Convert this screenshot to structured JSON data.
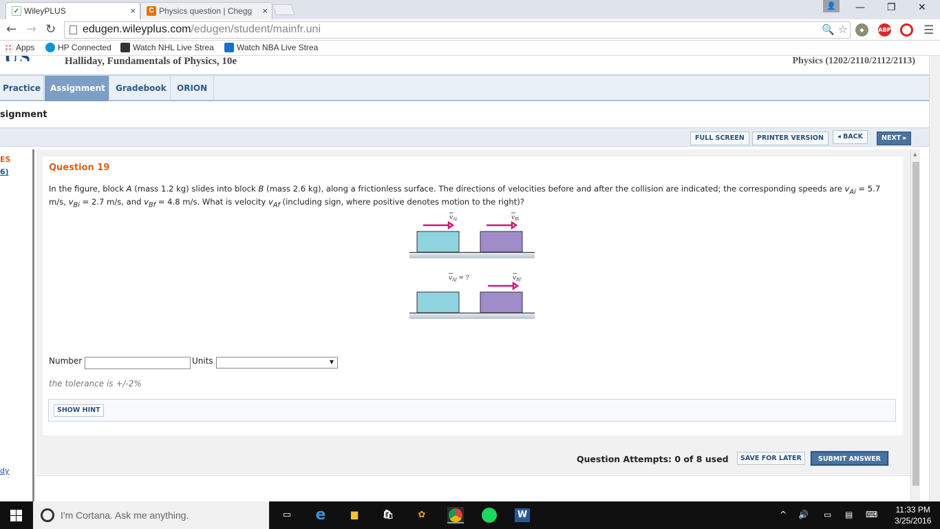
{
  "browser": {
    "tabs": [
      {
        "title": "WileyPLUS",
        "active": true
      },
      {
        "title": "Physics question | Chegg",
        "active": false
      }
    ],
    "tab_close": "×",
    "window_controls": {
      "minimize": "—",
      "restore": "❐",
      "close": "✕"
    },
    "url_host": "edugen.wileyplus.com",
    "url_path": "/edugen/student/mainfr.uni",
    "extension_abp": "ABP",
    "bookmarks": [
      {
        "label": "Apps",
        "icon": "apps-grid-icon"
      },
      {
        "label": "HP Connected",
        "icon": "hp-icon"
      },
      {
        "label": "Watch NHL Live Strea",
        "icon": "nhl-icon"
      },
      {
        "label": "Watch NBA Live Strea",
        "icon": "nba-icon"
      }
    ]
  },
  "wiley": {
    "book_title": "Halliday, Fundamentals of Physics, 10e",
    "course_title": "Physics (1202/2110/2112/2113)",
    "main_tabs": [
      "Practice",
      "Assignment",
      "Gradebook",
      "ORION"
    ],
    "active_tab": "Assignment",
    "breadcrumb": "signment",
    "toolbar": {
      "full_screen": "FULL SCREEN",
      "printer_version": "PRINTER VERSION",
      "back": "◂ BACK",
      "next": "NEXT ▸"
    },
    "left_strip": {
      "line1": "ES",
      "line2": "6)",
      "bottom_link": "dy"
    },
    "question": {
      "title": "Question 19",
      "text_parts": {
        "p1": "In the figure, block ",
        "A": "A",
        "p2": " (mass 1.2 kg) slides into block ",
        "B": "B",
        "p3": " (mass 2.6 kg), along a frictionless surface. The directions of velocities before and after the collision are indicated; the corresponding speeds are ",
        "vAi": "v",
        "vAi_sub": "Ai",
        "p4": " = 5.7 m/s, ",
        "vBi": "v",
        "vBi_sub": "Bi",
        "p5": " = 2.7 m/s, and ",
        "vBf": "v",
        "vBf_sub": "Bf",
        "p6": " = 4.8 m/s. What is velocity ",
        "vAf": "v",
        "vAf_sub": "Af",
        "p7": " (including sign, where positive denotes motion to the right)?"
      },
      "figure": {
        "label_vAi": "v",
        "label_vAi_sub": "Ai",
        "label_vBi": "v",
        "label_vBi_sub": "Bi",
        "label_vAf": "v",
        "label_vAf_sub": "Af",
        "label_vAf_suffix": " = ?",
        "label_vBf": "v",
        "label_vBf_sub": "Bf",
        "colors": {
          "block_a": "#8fd4df",
          "block_b": "#a08cc8",
          "arrow": "#d0197a",
          "floor": "#c9d3dc"
        }
      },
      "number_label": "Number",
      "number_value": "",
      "units_label": "Units",
      "units_value": "",
      "tolerance": "the tolerance is +/-2%",
      "show_hint": "SHOW HINT"
    },
    "attempts": "Question Attempts: 0 of 8 used",
    "save_for_later": "SAVE FOR LATER",
    "submit_answer": "SUBMIT ANSWER"
  },
  "taskbar": {
    "cortana_placeholder": "I'm Cortana. Ask me anything.",
    "word_icon_letter": "W",
    "edge_letter": "e",
    "time": "11:33 PM",
    "date": "3/25/2016",
    "tray_chevron": "^",
    "volume": "🔊"
  }
}
